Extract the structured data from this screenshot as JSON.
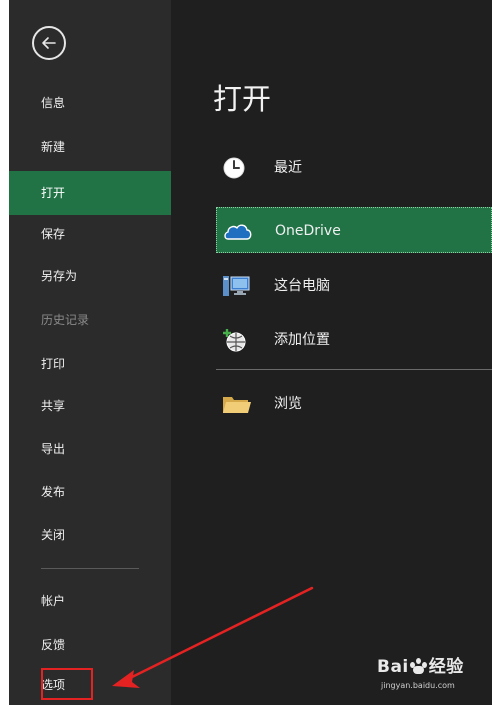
{
  "sidebar": {
    "items": [
      {
        "label": "信息"
      },
      {
        "label": "新建"
      },
      {
        "label": "打开"
      },
      {
        "label": "保存"
      },
      {
        "label": "另存为"
      },
      {
        "label": "历史记录"
      },
      {
        "label": "打印"
      },
      {
        "label": "共享"
      },
      {
        "label": "导出"
      },
      {
        "label": "发布"
      },
      {
        "label": "关闭"
      },
      {
        "label": "帐户"
      },
      {
        "label": "反馈"
      },
      {
        "label": "选项"
      }
    ],
    "active_item": "打开",
    "disabled_item": "历史记录"
  },
  "main": {
    "title": "打开",
    "locations": [
      {
        "label": "最近",
        "icon": "clock-icon"
      },
      {
        "label": "OneDrive",
        "icon": "cloud-icon"
      },
      {
        "label": "这台电脑",
        "icon": "computer-icon"
      },
      {
        "label": "添加位置",
        "icon": "add-location-icon"
      },
      {
        "label": "浏览",
        "icon": "folder-icon"
      }
    ],
    "selected_location": "OneDrive"
  },
  "watermark": {
    "brand_a": "Bai",
    "brand_b": "经验",
    "url": "jingyan.baidu.com"
  },
  "colors": {
    "accent": "#217346",
    "sidebar_bg": "#2b2b2b",
    "main_bg": "#1f1f1f",
    "annotation": "#e52222"
  }
}
